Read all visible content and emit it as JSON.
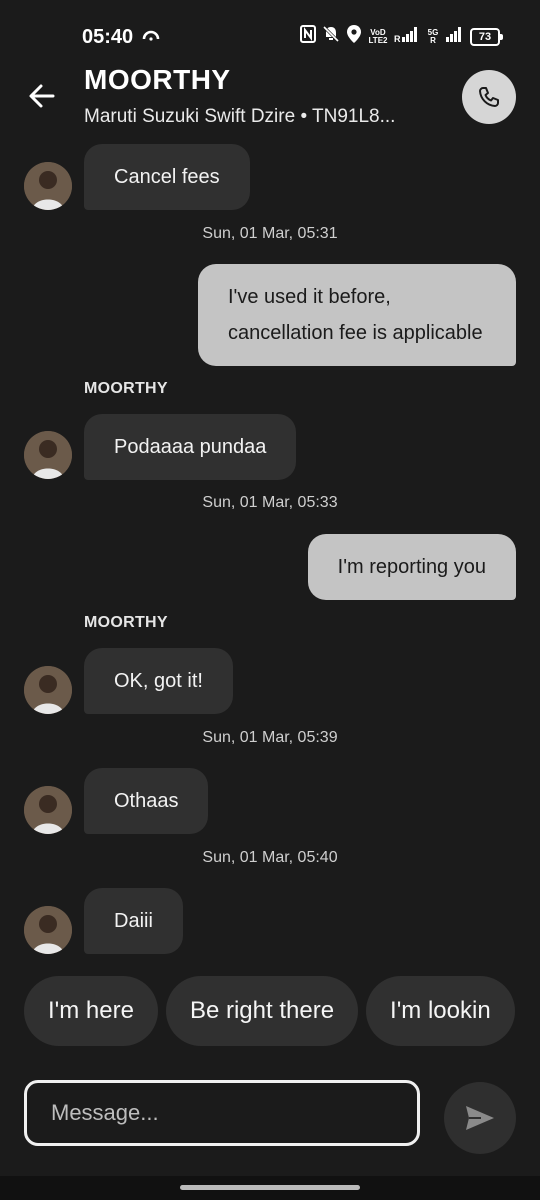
{
  "status_bar": {
    "time": "05:40",
    "network_1": "VoD\nLTE2",
    "network_2_top": "5G",
    "network_2_bottom": "R",
    "battery": "73"
  },
  "header": {
    "name": "MOORTHY",
    "vehicle": "Maruti Suzuki Swift Dzire • TN91L8..."
  },
  "messages": [
    {
      "dir": "in",
      "text": "Cancel fees"
    },
    {
      "ts": "Sun, 01 Mar, 05:31"
    },
    {
      "dir": "out",
      "text": "I've used it before, cancellation fee is applicable"
    },
    {
      "sender": "MOORTHY"
    },
    {
      "dir": "in",
      "text": "Podaaaa pundaa"
    },
    {
      "ts": "Sun, 01 Mar, 05:33"
    },
    {
      "dir": "out",
      "text": "I'm reporting you"
    },
    {
      "sender": "MOORTHY"
    },
    {
      "dir": "in",
      "text": "OK, got it!"
    },
    {
      "ts": "Sun, 01 Mar, 05:39"
    },
    {
      "dir": "in",
      "text": "Othaas"
    },
    {
      "ts": "Sun, 01 Mar, 05:40"
    },
    {
      "dir": "in",
      "text": "Daiii"
    }
  ],
  "quick_replies": [
    "I'm here",
    "Be right there",
    "I'm lookin"
  ],
  "composer": {
    "placeholder": "Message..."
  },
  "icons": {
    "back": "arrow-left-icon",
    "call": "phone-icon",
    "send": "send-icon"
  }
}
